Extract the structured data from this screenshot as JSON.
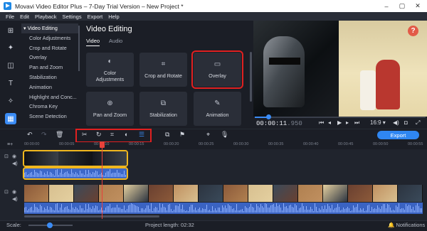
{
  "window": {
    "title": "Movavi Video Editor Plus – 7-Day Trial Version – New Project *",
    "controls": [
      "–",
      "▢",
      "✕"
    ]
  },
  "menu": [
    "File",
    "Edit",
    "Playback",
    "Settings",
    "Export",
    "Help"
  ],
  "sidebar_categories": {
    "header": "Video Editing",
    "items": [
      "Color Adjustments",
      "Crop and Rotate",
      "Overlay",
      "Pan and Zoom",
      "Stabilization",
      "Animation",
      "Highlight and Conc...",
      "Chroma Key",
      "Scene Detection"
    ]
  },
  "panel": {
    "title": "Video Editing",
    "tabs": [
      {
        "label": "Video",
        "active": true
      },
      {
        "label": "Audio",
        "active": false
      }
    ],
    "tiles": [
      {
        "label": "Color\nAdjustments",
        "icon": "color-adjust-icon"
      },
      {
        "label": "Crop and Rotate",
        "icon": "crop-rotate-icon"
      },
      {
        "label": "Overlay",
        "icon": "overlay-icon",
        "highlighted": true
      },
      {
        "label": "Pan and Zoom",
        "icon": "pan-zoom-icon"
      },
      {
        "label": "Stabilization",
        "icon": "stabilization-icon"
      },
      {
        "label": "Animation",
        "icon": "animation-icon"
      }
    ]
  },
  "player": {
    "timecode": "00:00:11",
    "timecode_ms": ".950",
    "aspect": "16:9",
    "progress": 0.08
  },
  "toolbar": {
    "export_label": "Export"
  },
  "ruler": {
    "labels": [
      "00:00:00",
      "00:00:05",
      "00:00:10",
      "00:00:15",
      "00:00:20",
      "00:00:25",
      "00:00:30",
      "00:00:35",
      "00:00:40",
      "00:00:45",
      "00:00:50",
      "00:00:55"
    ]
  },
  "status": {
    "scale_label": "Scale:",
    "project_length": "Project length: 02:32",
    "notifications": "Notifications",
    "scale_value": 0.45
  },
  "colors": {
    "accent": "#3b8cf5",
    "highlight": "#e02020",
    "selection": "#f0b71e",
    "playhead": "#e8413a"
  }
}
